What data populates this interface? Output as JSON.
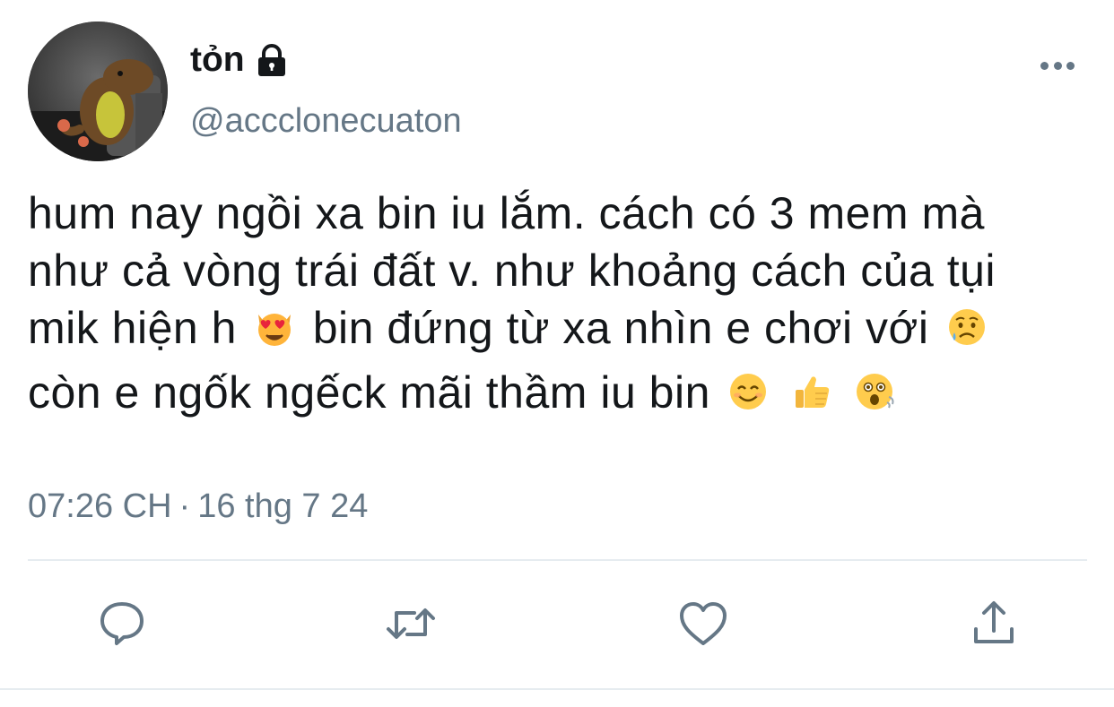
{
  "colors": {
    "primary_text": "#14171a",
    "secondary_text": "#657786",
    "divider": "#e6ecf0",
    "background": "#ffffff"
  },
  "author": {
    "display_name": "tỏn",
    "handle": "@accclonecuaton",
    "protected_icon": "lock-icon",
    "avatar": "plush-dinosaur-photo"
  },
  "tweet": {
    "lines": [
      "hum nay ngồi xa bin iu lắm. cách có 3 mem mà",
      "như cả vòng trái đất v. như khoảng cách của tụi",
      "mik hiện h",
      "bin đứng từ xa nhìn e chơi với",
      "còn e ngốk ngếck mãi thầm iu bin"
    ],
    "emojis": [
      "smiling-cat-heart-eyes-emoji",
      "sad-but-relieved-face-emoji",
      "smiling-face-emoji",
      "thumbs-up-emoji",
      "dizzy-face-emoji"
    ]
  },
  "meta": {
    "time": "07:26 CH",
    "separator": "·",
    "date": "16 thg 7 24"
  },
  "actions": {
    "reply_icon": "reply-icon",
    "retweet_icon": "retweet-icon",
    "like_icon": "heart-icon",
    "share_icon": "share-icon",
    "more_icon": "more-icon"
  }
}
